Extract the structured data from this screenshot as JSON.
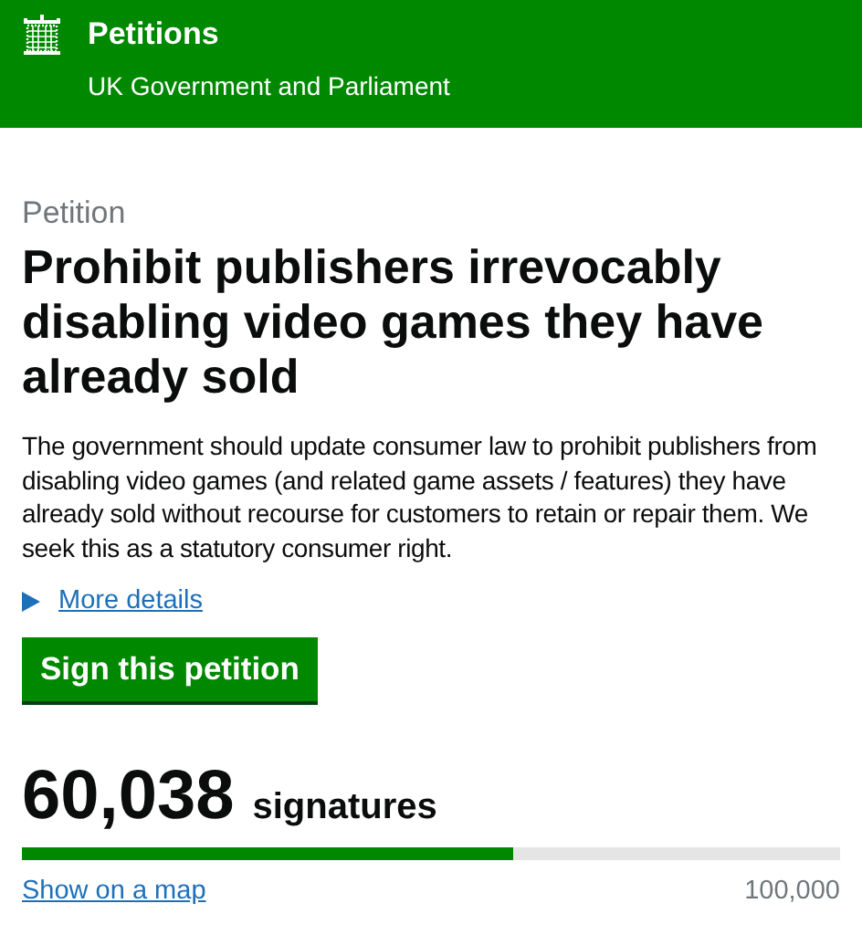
{
  "header": {
    "title": "Petitions",
    "subtitle": "UK Government and Parliament"
  },
  "petition": {
    "label": "Petition",
    "title": "Prohibit publishers irrevocably disabling video games they have already sold",
    "summary": "The government should update consumer law to prohibit publishers from disabling video games (and related game assets / features) they have already sold without recourse for customers to retain or repair them. We seek this as a statutory consumer right.",
    "details": {
      "label": "More details",
      "expanded": false
    },
    "sign_button": "Sign this petition"
  },
  "signatures": {
    "count": "60,038",
    "unit": "signatures",
    "level": 0.6,
    "map_link": "Show on a map",
    "target": "100,000"
  }
}
